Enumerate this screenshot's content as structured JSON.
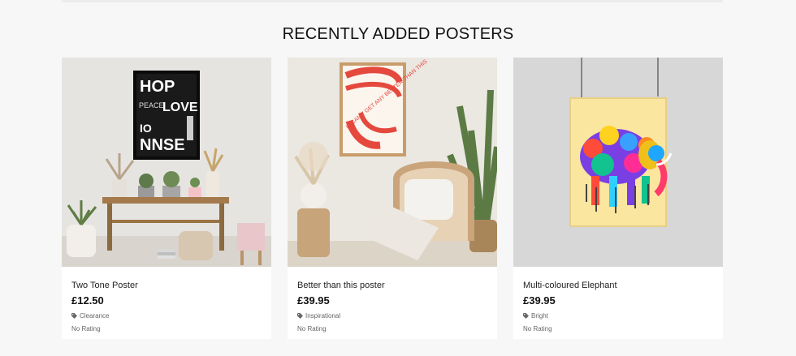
{
  "section": {
    "heading": "RECENTLY ADDED POSTERS"
  },
  "products": [
    {
      "title": "Two Tone Poster",
      "price": "£12.50",
      "category": "Clearance",
      "rating": "No Rating",
      "image_icon": "poster-image",
      "poster_words": [
        "HOP",
        "LOVE",
        "PEACE",
        "NNSE"
      ]
    },
    {
      "title": "Better than this poster",
      "price": "£39.95",
      "category": "Inspirational",
      "rating": "No Rating",
      "image_icon": "poster-image",
      "poster_words": [
        "IT CAN'T GET ANY BETTER THAN THIS"
      ]
    },
    {
      "title": "Multi-coloured Elephant",
      "price": "£39.95",
      "category": "Bright",
      "rating": "No Rating",
      "image_icon": "poster-image"
    }
  ],
  "colors": {
    "page_bg": "#f7f7f7",
    "card_bg": "#ffffff",
    "accent_red": "#e5483d"
  }
}
